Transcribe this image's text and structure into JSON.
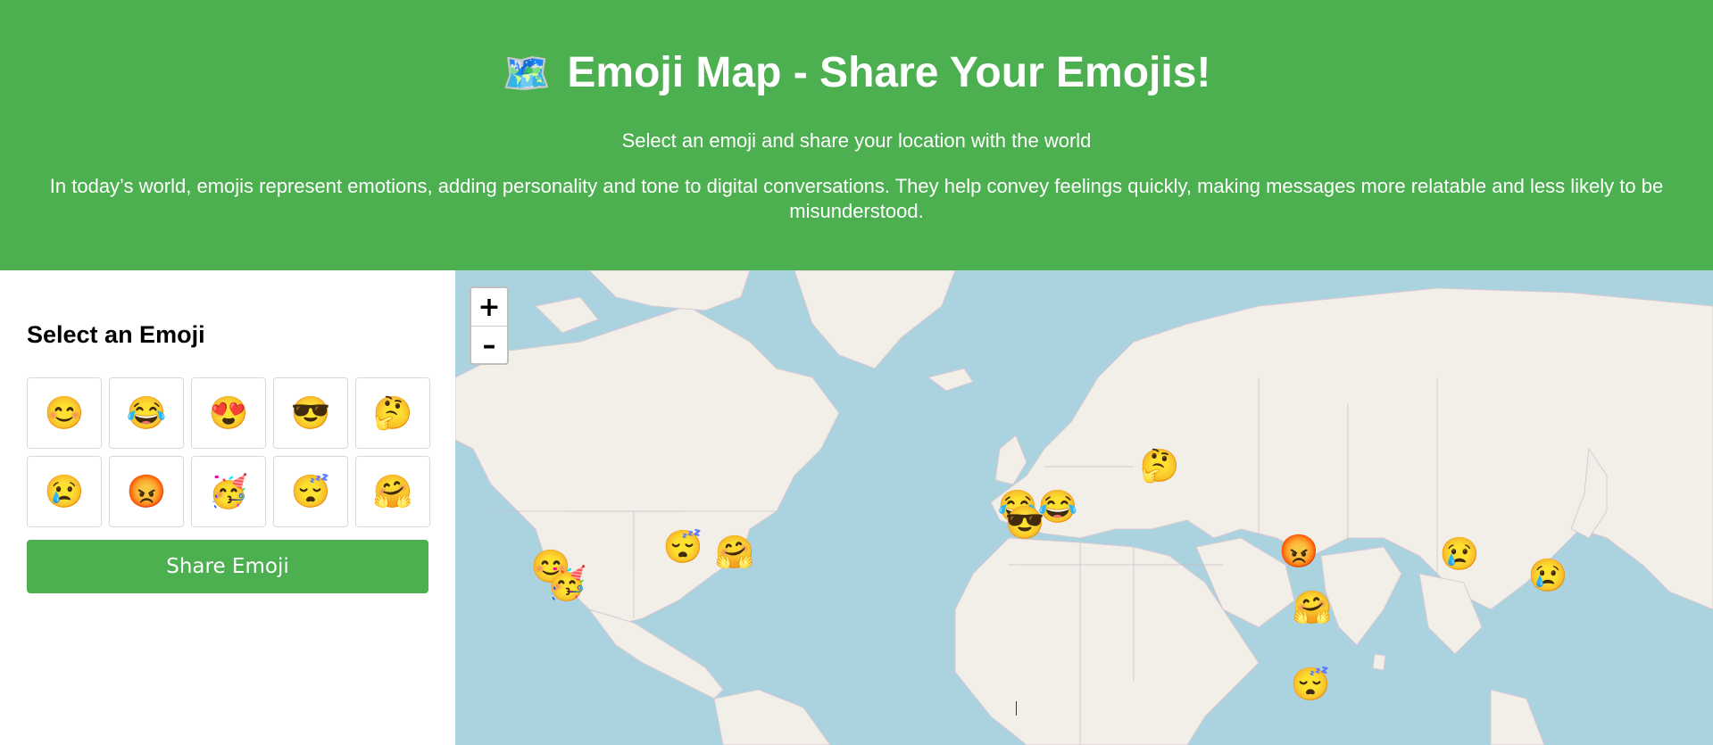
{
  "header": {
    "title": "Emoji Map - Share Your Emojis!",
    "title_icon": "🗺️",
    "subtitle": "Select an emoji and share your location with the world",
    "description": "In today’s world, emojis represent emotions, adding personality and tone to digital conversations. They help convey feelings quickly, making messages more relatable and less likely to be misunderstood."
  },
  "sidebar": {
    "heading": "Select an Emoji",
    "emojis": [
      "😊",
      "😂",
      "😍",
      "😎",
      "🤔",
      "😢",
      "😡",
      "🥳",
      "😴",
      "🤗"
    ],
    "share_label": "Share Emoji"
  },
  "map": {
    "zoom_in": "+",
    "zoom_out": "–",
    "markers": [
      "😊",
      "🥳",
      "😴",
      "🤗",
      "😂",
      "😎",
      "😂",
      "🤔",
      "😡",
      "🤗",
      "😴",
      "😢",
      "😢"
    ]
  },
  "colors": {
    "header_bg": "#4caf50",
    "button_bg": "#4caf50",
    "water": "#aad3df",
    "land": "#f2efe9"
  }
}
